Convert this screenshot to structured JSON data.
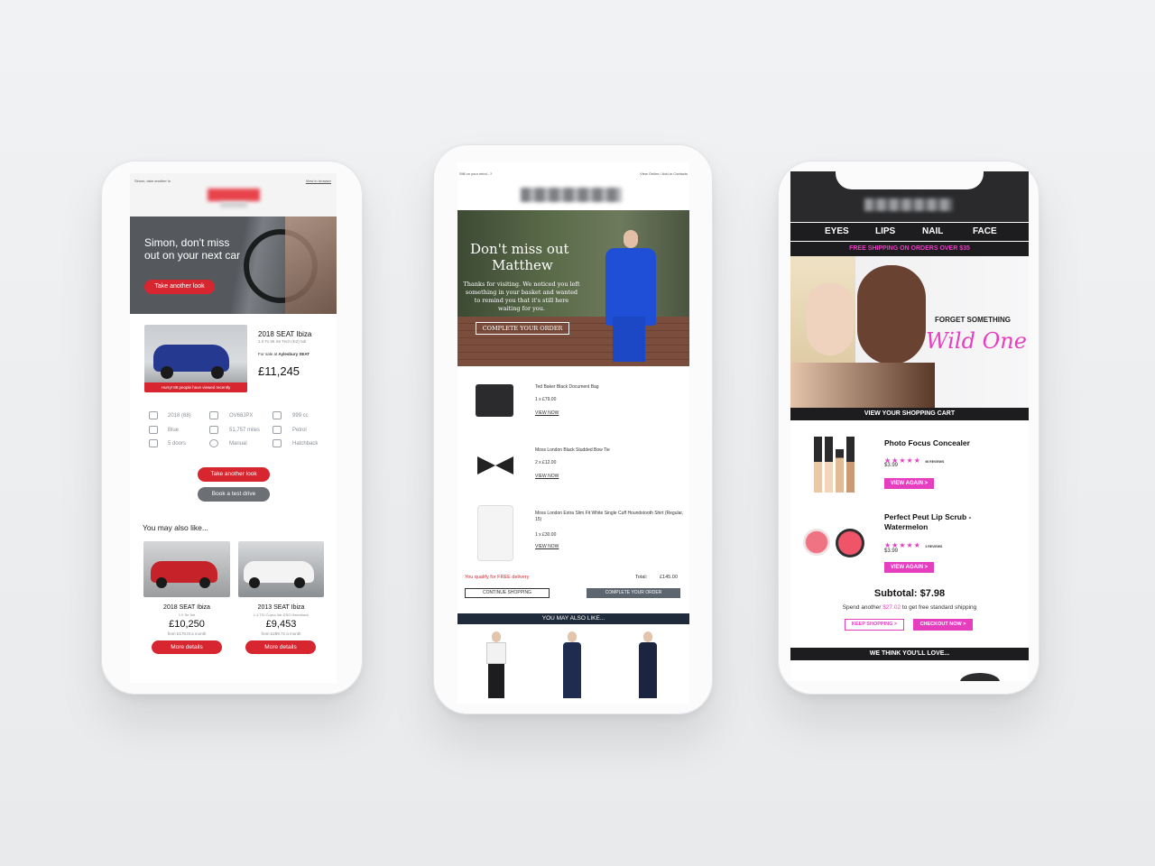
{
  "colors": {
    "car_red": "#d7262f",
    "pink": "#e53ebf",
    "dark": "#2a2a2c",
    "navy": "#1f2a3a"
  },
  "phone1": {
    "top_left": "Simon, take another lo",
    "top_right": "View in browser",
    "hero_heading": "Simon, don't miss out on your next car",
    "hero_button": "Take another look",
    "car_name": "2018 SEAT Ibiza",
    "car_variant": "1.0 To 95 Se Tech (EZ) 5dr",
    "for_sale_label": "For sale at",
    "dealer": "Aylesbury SEAT",
    "price": "£11,245",
    "hurry_banner": "Hurry! 89 people have viewed recently",
    "specs": [
      "2018 (68)",
      "OV68JPX",
      "999 cc",
      "Blue",
      "51,757 miles",
      "Petrol",
      "5 doors",
      "Manual",
      "Hatchback"
    ],
    "btn_take_another": "Take another look",
    "btn_test_drive": "Book a test drive",
    "also_like": "You may also like...",
    "recs": [
      {
        "name": "2018 SEAT Ibiza",
        "variant": "1.0 Se 5dr",
        "price": "£10,250",
        "monthly": "from £178.0t a month",
        "button": "More details"
      },
      {
        "name": "2013 SEAT Ibiza",
        "variant": "1.4 TSI Cupra 3dr DSG Hatchback",
        "price": "£9,453",
        "monthly": "from £289.72 a month",
        "button": "More details"
      }
    ]
  },
  "phone2": {
    "top_left": "Still on your mind...?",
    "top_right": "View Online / Add to Contacts",
    "hero_heading_line1": "Don't miss out",
    "hero_heading_line2": "Matthew",
    "hero_body": "Thanks for visiting. We noticed you left something in your basket and wanted to remind you that it's still here waiting for you.",
    "hero_button": "COMPLETE YOUR ORDER",
    "items": [
      {
        "name": "Ted Baker Black Document Bag",
        "qty": "1 x £79.00",
        "link": "VIEW NOW"
      },
      {
        "name": "Moss London Black Studded Bow Tie",
        "qty": "2 x £12.00",
        "link": "VIEW NOW"
      },
      {
        "name": "Moss London Extra Slim Fit White Single Cuff Houndstooth Shirt (Regular, 15)",
        "qty": "1 x £30.00",
        "link": "VIEW NOW"
      }
    ],
    "free_delivery": "You qualify for FREE delivery",
    "total_label": "Total:",
    "total_value": "£145.00",
    "btn_continue": "CONTINUE SHOPPING",
    "btn_complete": "COMPLETE YOUR ORDER",
    "also_like": "YOU MAY ALSO LIKE..."
  },
  "phone3": {
    "nav": [
      "EYES",
      "LIPS",
      "NAIL",
      "FACE"
    ],
    "shipping_banner": "FREE SHIPPING ON ORDERS OVER $35",
    "hero_line1": "FORGET SOMETHING",
    "hero_script": "Wild One?",
    "cart_bar": "VIEW YOUR SHOPPING CART",
    "products": [
      {
        "name": "Photo Focus Concealer",
        "reviews": "96 REVIEWS",
        "price": "$3.99",
        "button": "VIEW AGAIN >"
      },
      {
        "name": "Perfect Peut Lip Scrub - Watermelon",
        "reviews": "3 REVIEWS",
        "price": "$3.99",
        "button": "VIEW AGAIN >"
      }
    ],
    "subtotal": "Subtotal: $7.98",
    "spend_prefix": "Spend another",
    "spend_amount": "$27.02",
    "spend_suffix": "to get free standard shipping",
    "btn_keep": "KEEP SHOPPING >",
    "btn_checkout": "CHECKOUT NOW >",
    "footer_bar": "WE THINK YOU'LL LOVE..."
  }
}
